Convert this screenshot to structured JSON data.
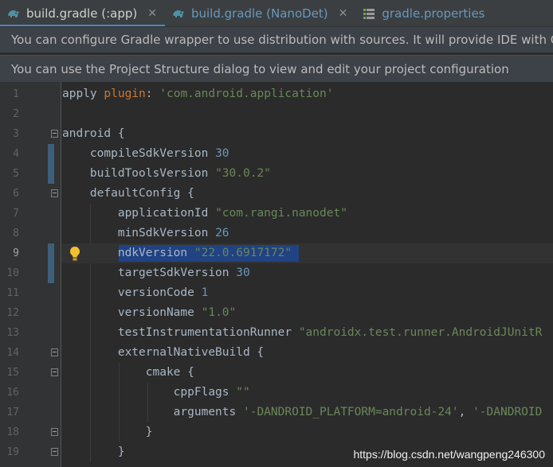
{
  "tabs": [
    {
      "label": "build.gradle (:app)",
      "active": true,
      "icon": "gradle-elephant-icon"
    },
    {
      "label": "build.gradle (NanoDet)",
      "active": false,
      "icon": "gradle-elephant-icon"
    },
    {
      "label": "gradle.properties",
      "active": false,
      "icon": "properties-file-icon"
    }
  ],
  "banners": {
    "wrapper": "You can configure Gradle wrapper to use distribution with sources. It will provide IDE with Gra",
    "project_structure": "You can use the Project Structure dialog to view and edit your project configuration"
  },
  "editor": {
    "current_line": 9,
    "lines": [
      {
        "n": "1",
        "parts": [
          [
            "plain",
            "apply "
          ],
          [
            "kw",
            "plugin"
          ],
          [
            "plain",
            ": "
          ],
          [
            "str",
            "'com.android.application'"
          ]
        ]
      },
      {
        "n": "2",
        "parts": []
      },
      {
        "n": "3",
        "parts": [
          [
            "plain",
            "android {"
          ]
        ]
      },
      {
        "n": "4",
        "parts": [
          [
            "plain",
            "    compileSdkVersion "
          ],
          [
            "num",
            "30"
          ]
        ]
      },
      {
        "n": "5",
        "parts": [
          [
            "plain",
            "    buildToolsVersion "
          ],
          [
            "str",
            "\"30.0.2\""
          ]
        ]
      },
      {
        "n": "6",
        "parts": [
          [
            "plain",
            "    defaultConfig {"
          ]
        ]
      },
      {
        "n": "7",
        "parts": [
          [
            "plain",
            "        applicationId "
          ],
          [
            "str",
            "\"com.rangi.nanodet\""
          ]
        ]
      },
      {
        "n": "8",
        "parts": [
          [
            "plain",
            "        minSdkVersion "
          ],
          [
            "num",
            "26"
          ]
        ]
      },
      {
        "n": "9",
        "parts": [
          [
            "plain",
            "        ndkVersion "
          ],
          [
            "str",
            "\"22.0.6917172\""
          ]
        ]
      },
      {
        "n": "10",
        "parts": [
          [
            "plain",
            "        targetSdkVersion "
          ],
          [
            "num",
            "30"
          ]
        ]
      },
      {
        "n": "11",
        "parts": [
          [
            "plain",
            "        versionCode "
          ],
          [
            "num",
            "1"
          ]
        ]
      },
      {
        "n": "12",
        "parts": [
          [
            "plain",
            "        versionName "
          ],
          [
            "str",
            "\"1.0\""
          ]
        ]
      },
      {
        "n": "13",
        "parts": [
          [
            "plain",
            "        testInstrumentationRunner "
          ],
          [
            "str",
            "\"androidx.test.runner.AndroidJUnitR"
          ]
        ]
      },
      {
        "n": "14",
        "parts": [
          [
            "plain",
            "        externalNativeBuild {"
          ]
        ]
      },
      {
        "n": "15",
        "parts": [
          [
            "plain",
            "            cmake {"
          ]
        ]
      },
      {
        "n": "16",
        "parts": [
          [
            "plain",
            "                cppFlags "
          ],
          [
            "str",
            "\"\""
          ]
        ]
      },
      {
        "n": "17",
        "parts": [
          [
            "plain",
            "                arguments "
          ],
          [
            "str",
            "'-DANDROID_PLATFORM=android-24'"
          ],
          [
            "plain",
            ", "
          ],
          [
            "str",
            "'-DANDROID"
          ]
        ]
      },
      {
        "n": "18",
        "parts": [
          [
            "plain",
            "            }"
          ]
        ]
      },
      {
        "n": "19",
        "parts": [
          [
            "plain",
            "        }"
          ]
        ]
      }
    ]
  },
  "watermark": "https://blog.csdn.net/wangpeng246300",
  "colors": {
    "background": "#2b2b2b",
    "keyword": "#cc7832",
    "string": "#6a8759",
    "number": "#6897bb",
    "selection": "#214283",
    "tab_underline": "#4a88c7"
  }
}
